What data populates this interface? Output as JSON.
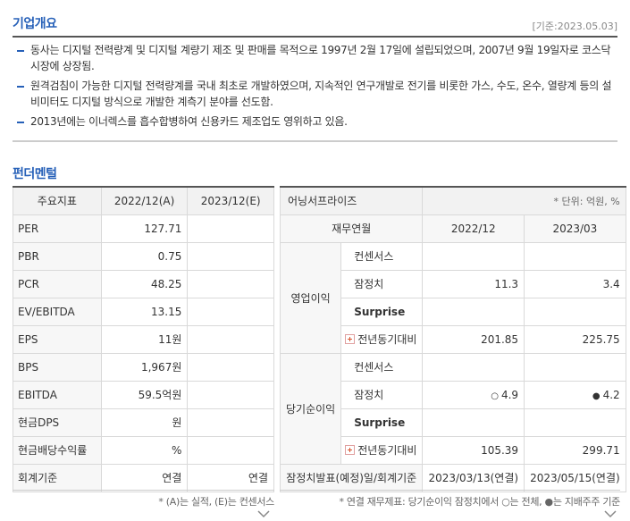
{
  "overview": {
    "title": "기업개요",
    "base_date": "[기준:2023.05.03]",
    "bullets": [
      "동사는 디지털 전력량계 및 디지털 계량기 제조 및 판매를 목적으로 1997년 2월 17일에 설립되었으며, 2007년 9월 19일자로 코스닥시장에 상장됨.",
      "원격검침이 가능한 디지털 전력량계를 국내 최초로 개발하였으며, 지속적인 연구개발로 전기를 비롯한 가스, 수도, 온수, 열량계 등의 설비미터도 디지털 방식으로 개발한 계측기 분야를 선도함.",
      "2013년에는 이너렉스를 흡수합병하여 신용카드 제조업도 영위하고 있음."
    ]
  },
  "fundamental": {
    "title": "펀더멘털",
    "left_table": {
      "headers": [
        "주요지표",
        "2022/12(A)",
        "2023/12(E)"
      ],
      "rows": [
        {
          "label": "PER",
          "a": "127.71",
          "e": ""
        },
        {
          "label": "PBR",
          "a": "0.75",
          "e": ""
        },
        {
          "label": "PCR",
          "a": "48.25",
          "e": ""
        },
        {
          "label": "EV/EBITDA",
          "a": "13.15",
          "e": ""
        },
        {
          "label": "EPS",
          "a": "11원",
          "e": ""
        },
        {
          "label": "BPS",
          "a": "1,967원",
          "e": ""
        },
        {
          "label": "EBITDA",
          "a": "59.5억원",
          "e": ""
        },
        {
          "label": "현금DPS",
          "a": "원",
          "e": ""
        },
        {
          "label": "현금배당수익률",
          "a": "%",
          "e": ""
        },
        {
          "label": "회계기준",
          "a": "연결",
          "e": "연결"
        }
      ],
      "note": "* (A)는 실적, (E)는 컨센서스"
    },
    "right_table": {
      "title": "어닝서프라이즈",
      "unit": "* 단위: 억원, %",
      "headers": [
        "재무연월",
        "2022/12",
        "2023/03"
      ],
      "groups": [
        {
          "name": "영업이익",
          "rows": [
            {
              "label": "컨센서스",
              "v1": "",
              "v2": ""
            },
            {
              "label": "잠정치",
              "v1": "11.3",
              "v2": "3.4"
            },
            {
              "label": "Surprise",
              "v1": "",
              "v2": ""
            },
            {
              "label": "전년동기대비",
              "v1": "201.85",
              "v2": "225.75"
            }
          ]
        },
        {
          "name": "당기순이익",
          "rows": [
            {
              "label": "컨센서스",
              "v1": "",
              "v2": ""
            },
            {
              "label": "잠정치",
              "v1": "4.9",
              "v2": "4.2"
            },
            {
              "label": "Surprise",
              "v1": "",
              "v2": ""
            },
            {
              "label": "전년동기대비",
              "v1": "105.39",
              "v2": "299.71"
            }
          ]
        }
      ],
      "marks": {
        "open": "○",
        "filled": "●"
      },
      "footer": {
        "label": "잠정치발표(예정)일/회계기준",
        "v1": "2023/03/13(연결)",
        "v2": "2023/05/15(연결)"
      },
      "note": "* 연결 재무제표: 당기순이익 잠정치에서 ○는 전체, ●는 지배주주 기준"
    }
  }
}
